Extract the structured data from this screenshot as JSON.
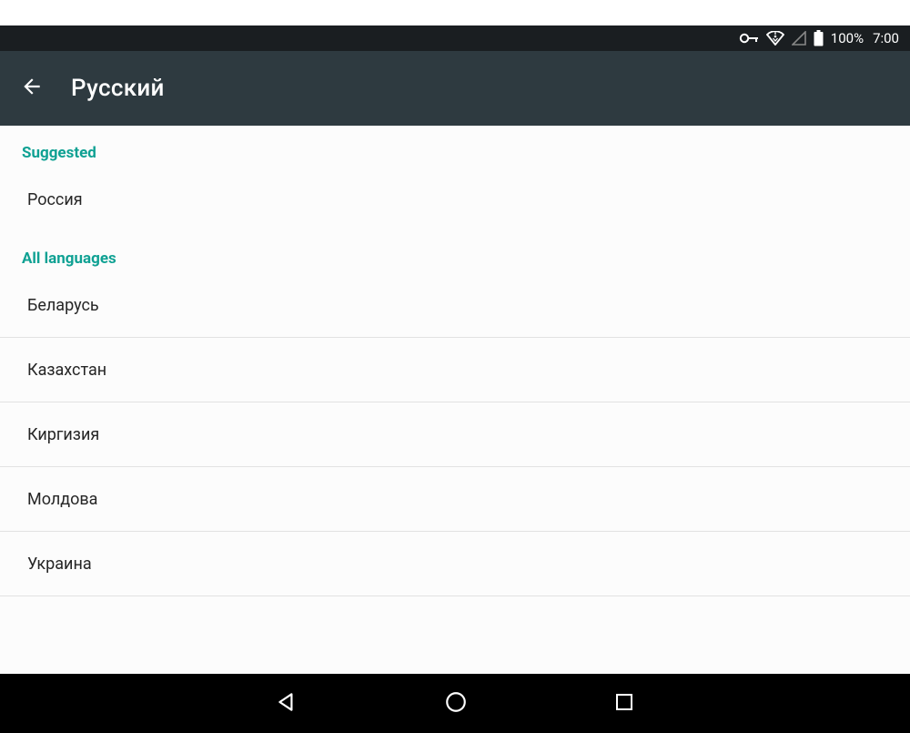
{
  "statusBar": {
    "batteryPercent": "100%",
    "time": "7:00"
  },
  "appBar": {
    "title": "Русский"
  },
  "sections": {
    "suggestedHeader": "Suggested",
    "allHeader": "All languages",
    "suggested": [
      {
        "label": "Россия"
      }
    ],
    "all": [
      {
        "label": "Беларусь"
      },
      {
        "label": "Казахстан"
      },
      {
        "label": "Киргизия"
      },
      {
        "label": "Молдова"
      },
      {
        "label": "Украина"
      }
    ]
  }
}
